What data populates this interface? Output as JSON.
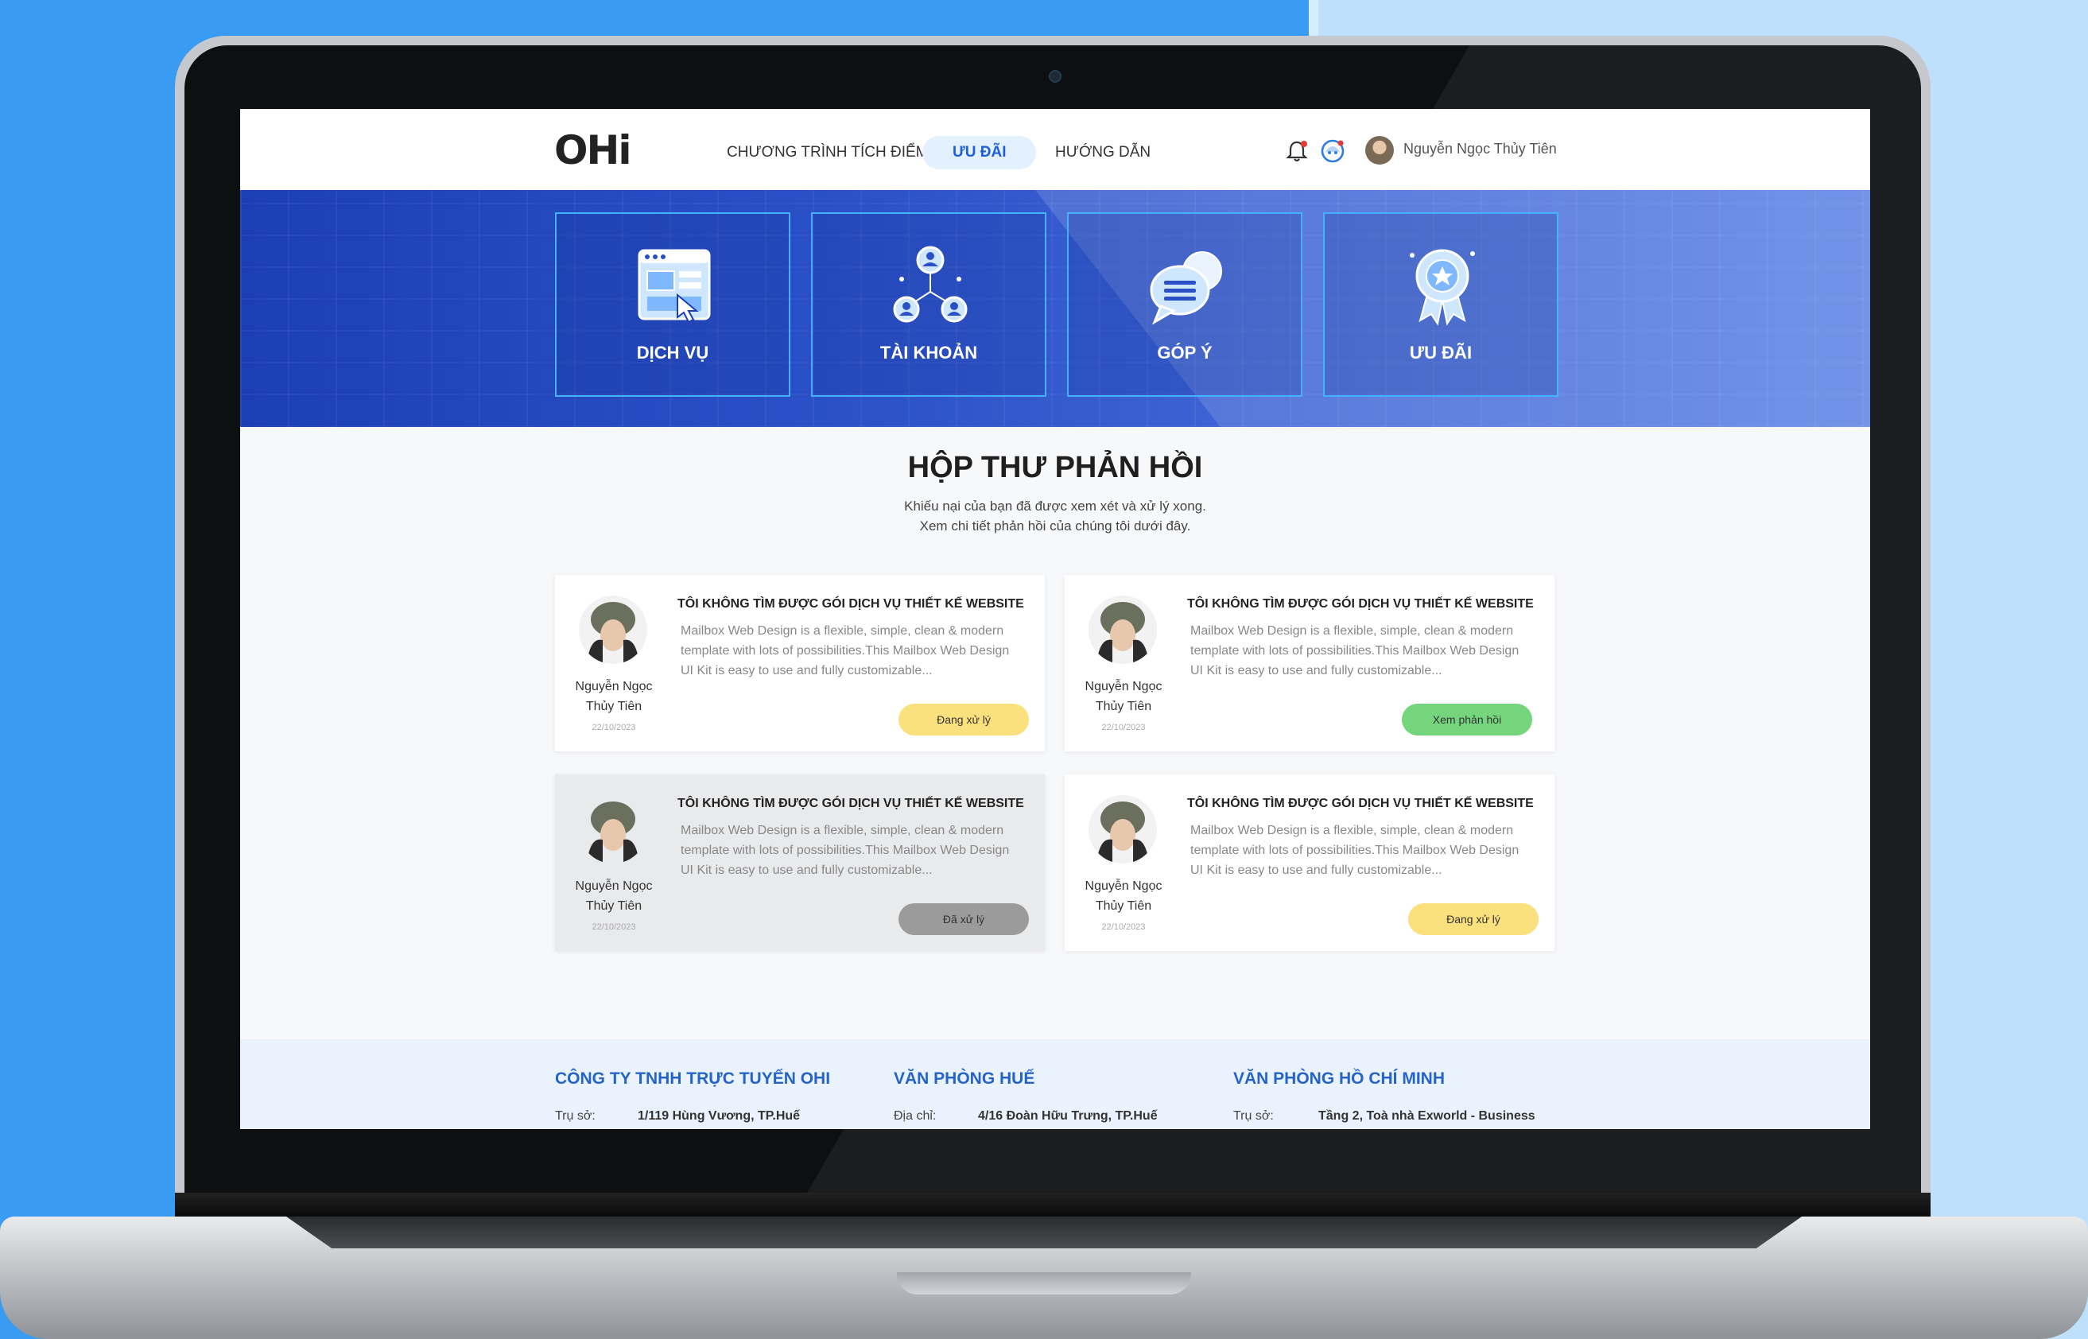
{
  "header": {
    "logo": "OHi",
    "nav": [
      "CHƯƠNG TRÌNH TÍCH ĐIỂM",
      "ƯU ĐÃI",
      "HƯỚNG DẪN"
    ],
    "active_nav": "ƯU ĐÃI",
    "user_name": "Nguyễn Ngọc Thủy Tiên",
    "icons": [
      "bell-icon",
      "support-icon"
    ]
  },
  "banner": {
    "tiles": [
      {
        "label": "DỊCH VỤ",
        "icon": "service-window-icon"
      },
      {
        "label": "TÀI KHOẢN",
        "icon": "account-network-icon"
      },
      {
        "label": "GÓP Ý",
        "icon": "feedback-chat-icon"
      },
      {
        "label": "ƯU ĐÃI",
        "icon": "award-badge-icon"
      }
    ]
  },
  "main": {
    "title": "HỘP THƯ PHẢN HỒI",
    "subtitle_line1": "Khiếu nại của bạn đã được xem xét và xử lý xong.",
    "subtitle_line2": "Xem chi tiết phản hồi của chúng tôi dưới đây.",
    "cards": [
      {
        "name_line1": "Nguyễn Ngọc",
        "name_line2": "Thủy Tiên",
        "date": "22/10/2023",
        "title": "TÔI KHÔNG TÌM ĐƯỢC GÓI DỊCH VỤ THIẾT KẾ WEBSITE",
        "text": "Mailbox Web Design is a flexible, simple, clean & modern template with lots of possibilities.This Mailbox Web Design UI Kit is easy to use and fully customizable...",
        "button": "Đang xử lý",
        "status": "yellow"
      },
      {
        "name_line1": "Nguyễn Ngọc",
        "name_line2": "Thủy Tiên",
        "date": "22/10/2023",
        "title": "TÔI KHÔNG TÌM ĐƯỢC GÓI DỊCH VỤ THIẾT KẾ WEBSITE",
        "text": "Mailbox Web Design is a flexible, simple, clean & modern template with lots of possibilities.This Mailbox Web Design UI Kit is easy to use and fully customizable...",
        "button": "Xem phản hồi",
        "status": "green"
      },
      {
        "name_line1": "Nguyễn Ngọc",
        "name_line2": "Thủy Tiên",
        "date": "22/10/2023",
        "title": "TÔI KHÔNG TÌM ĐƯỢC GÓI DỊCH VỤ THIẾT KẾ WEBSITE",
        "text": "Mailbox Web Design is a flexible, simple, clean & modern template with lots of possibilities.This Mailbox Web Design UI Kit is easy to use and fully customizable...",
        "button": "Đã xử lý",
        "status": "gray"
      },
      {
        "name_line1": "Nguyễn Ngọc",
        "name_line2": "Thủy Tiên",
        "date": "22/10/2023",
        "title": "TÔI KHÔNG TÌM ĐƯỢC GÓI DỊCH VỤ THIẾT KẾ WEBSITE",
        "text": "Mailbox Web Design is a flexible, simple, clean & modern template with lots of possibilities.This Mailbox Web Design UI Kit is easy to use and fully customizable...",
        "button": "Đang xử lý",
        "status": "yellow"
      }
    ]
  },
  "footer": {
    "cols": [
      {
        "heading": "CÔNG TY TNHH TRỰC TUYẾN OHI",
        "key": "Trụ sở:",
        "value": "1/119 Hùng Vương, TP.Huế"
      },
      {
        "heading": "VĂN PHÒNG HUẾ",
        "key": "Địa chỉ:",
        "value": "4/16 Đoàn Hữu Trưng, TP.Huế"
      },
      {
        "heading": "VĂN PHÒNG HỒ CHÍ MINH",
        "key": "Trụ sở:",
        "value": "Tầng 2, Toà nhà Exworld - Business"
      }
    ]
  },
  "colors": {
    "accent": "#1e5fd6",
    "banner": "#2a4fc6",
    "status_yellow": "#fbe07e",
    "status_green": "#74d57d",
    "status_gray": "#9b9b9b",
    "background": "#3a9bf2"
  }
}
